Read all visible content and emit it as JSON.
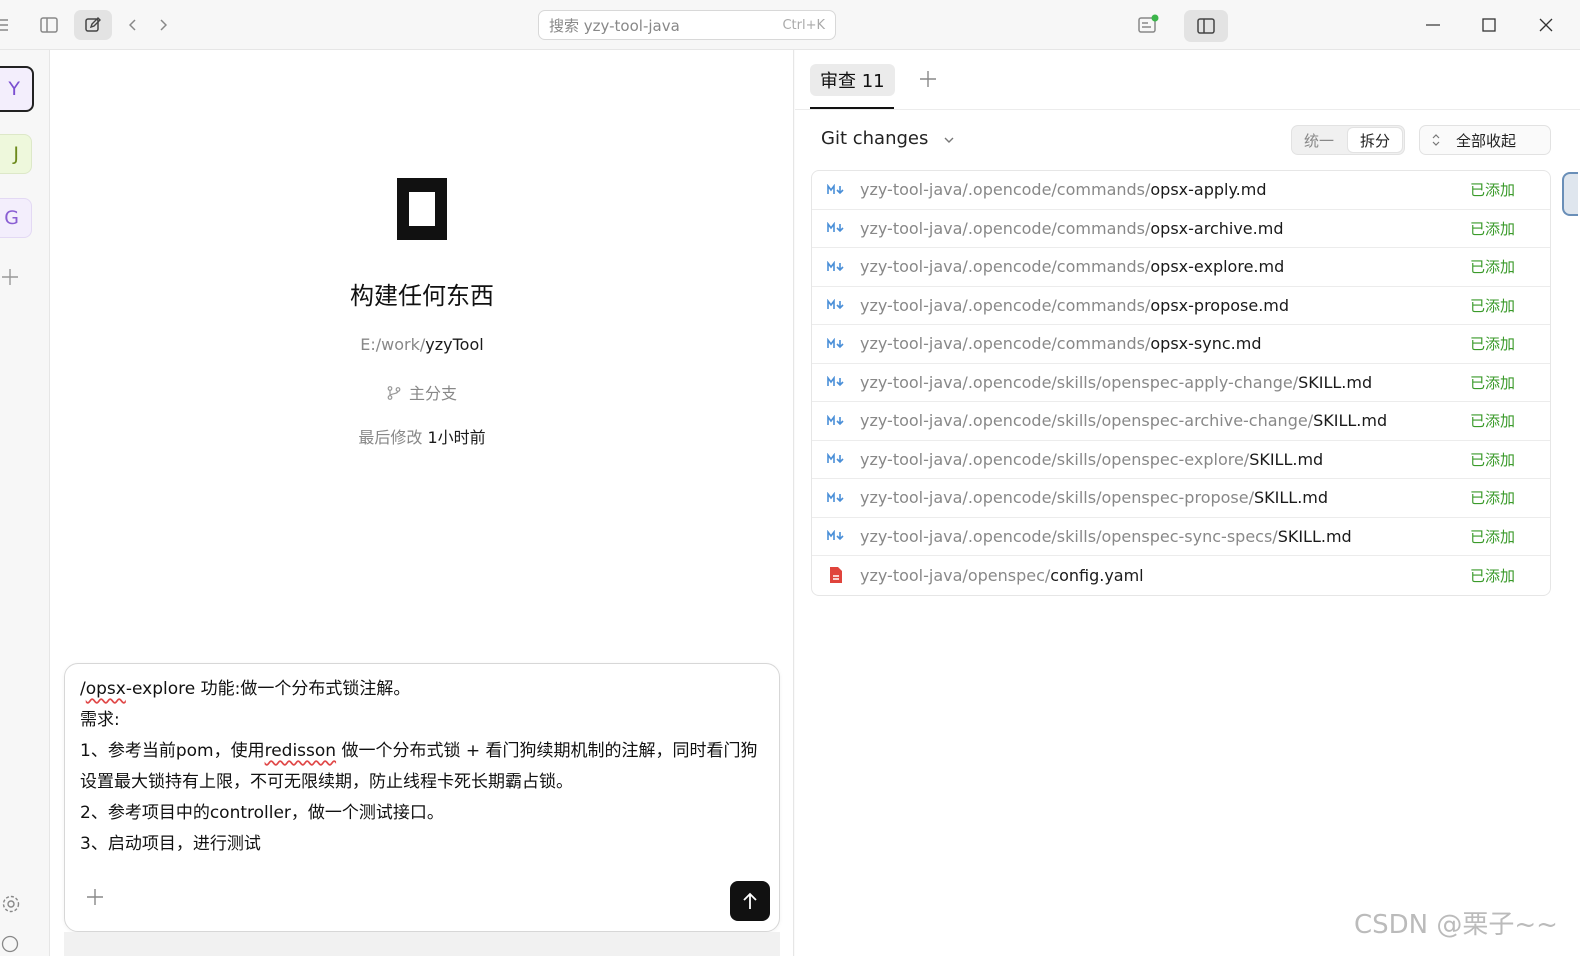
{
  "topbar": {
    "search_placeholder": "搜索 yzy-tool-java",
    "search_shortcut": "Ctrl+K"
  },
  "rail": {
    "workspaces": [
      {
        "letter": "Y",
        "color": "#7b4fd1"
      },
      {
        "letter": "J",
        "color": "#6d8a1c"
      },
      {
        "letter": "G",
        "color": "#8a5ed3"
      }
    ]
  },
  "main": {
    "title": "构建任何东西",
    "path_prefix": "E:/work/",
    "path_name": "yzyTool",
    "branch": "主分支",
    "modified_label": "最后修改",
    "modified_value": "1小时前",
    "composer": {
      "line1_a": "/",
      "line1_b": "opsx",
      "line1_c": "-explore 功能:做一个分布式锁注解。",
      "line2": "需求:",
      "line3_a": "1、参考当前pom，使用",
      "line3_b": "redisson",
      "line3_c": " 做一个分布式锁 + 看门狗续期机制的注解，同时看门狗设置最大锁持有上限，不可无限续期，防止线程卡死长期霸占锁。",
      "line4": "2、参考项目中的controller，做一个测试接口。",
      "line5": "3、启动项目，进行测试"
    }
  },
  "review": {
    "tab_label": "审查 11",
    "section_title": "Git changes",
    "seg_unified": "统一",
    "seg_split": "拆分",
    "collapse_all": "全部收起",
    "files": [
      {
        "dir": "yzy-tool-java/.opencode/commands/",
        "name": "opsx-apply.md",
        "status": "已添加",
        "type": "md"
      },
      {
        "dir": "yzy-tool-java/.opencode/commands/",
        "name": "opsx-archive.md",
        "status": "已添加",
        "type": "md"
      },
      {
        "dir": "yzy-tool-java/.opencode/commands/",
        "name": "opsx-explore.md",
        "status": "已添加",
        "type": "md"
      },
      {
        "dir": "yzy-tool-java/.opencode/commands/",
        "name": "opsx-propose.md",
        "status": "已添加",
        "type": "md"
      },
      {
        "dir": "yzy-tool-java/.opencode/commands/",
        "name": "opsx-sync.md",
        "status": "已添加",
        "type": "md"
      },
      {
        "dir": "yzy-tool-java/.opencode/skills/openspec-apply-change/",
        "name": "SKILL.md",
        "status": "已添加",
        "type": "md"
      },
      {
        "dir": "yzy-tool-java/.opencode/skills/openspec-archive-change/",
        "name": "SKILL.md",
        "status": "已添加",
        "type": "md"
      },
      {
        "dir": "yzy-tool-java/.opencode/skills/openspec-explore/",
        "name": "SKILL.md",
        "status": "已添加",
        "type": "md"
      },
      {
        "dir": "yzy-tool-java/.opencode/skills/openspec-propose/",
        "name": "SKILL.md",
        "status": "已添加",
        "type": "md"
      },
      {
        "dir": "yzy-tool-java/.opencode/skills/openspec-sync-specs/",
        "name": "SKILL.md",
        "status": "已添加",
        "type": "md"
      },
      {
        "dir": "yzy-tool-java/openspec/",
        "name": "config.yaml",
        "status": "已添加",
        "type": "yaml"
      }
    ]
  },
  "watermark": "CSDN @栗子~~",
  "colors": {
    "status_added": "#3a9a2a",
    "md_icon": "#4a8fd8",
    "yaml_icon": "#e0443c"
  }
}
